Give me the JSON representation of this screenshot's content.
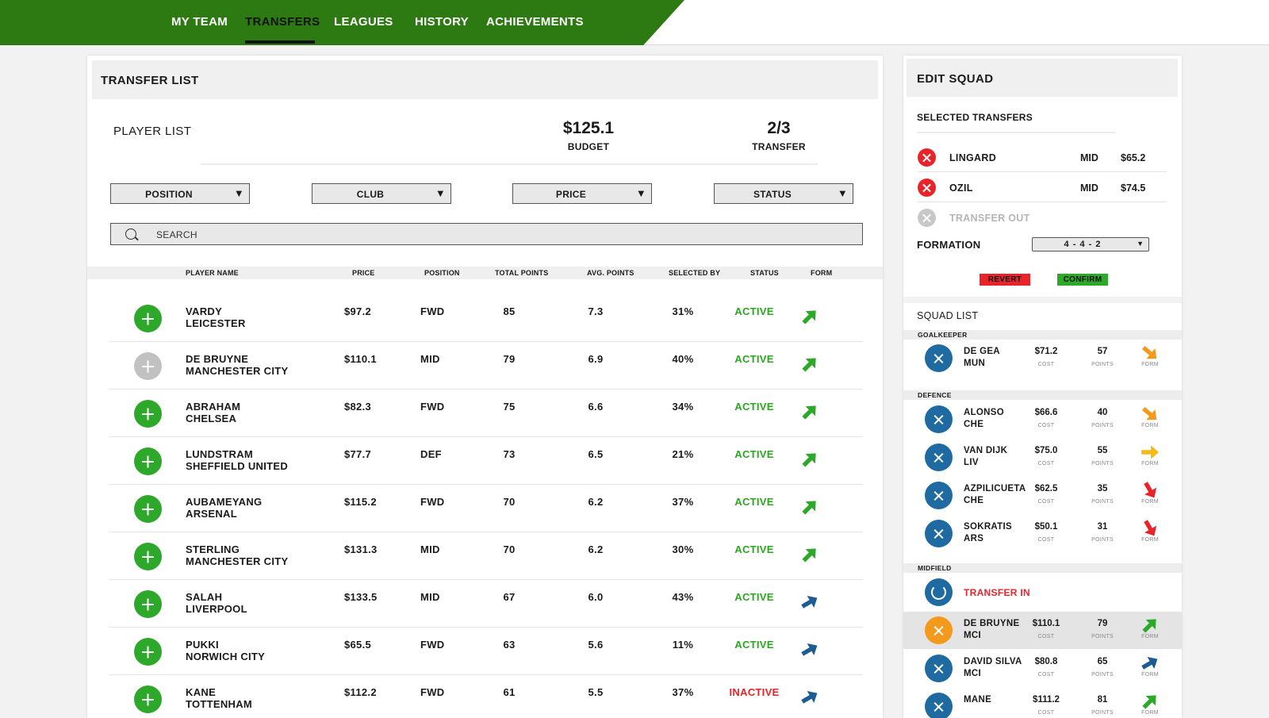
{
  "nav": {
    "items": [
      {
        "label": "MY TEAM"
      },
      {
        "label": "TRANSFERS"
      },
      {
        "label": "LEAGUES"
      },
      {
        "label": "HISTORY"
      },
      {
        "label": "ACHIEVEMENTS"
      }
    ],
    "active": "TRANSFERS"
  },
  "transfer_list": {
    "title": "TRANSFER LIST",
    "player_list_title": "PLAYER LIST",
    "budget_value": "$125.1",
    "budget_label": "BUDGET",
    "transfer_value": "2/3",
    "transfer_label": "TRANSFER",
    "filters": [
      "POSITION",
      "CLUB",
      "PRICE",
      "STATUS"
    ],
    "search_placeholder": "SEARCH",
    "columns": [
      "PLAYER NAME",
      "PRICE",
      "POSITION",
      "TOTAL POINTS",
      "AVG. POINTS",
      "SELECTED BY",
      "STATUS",
      "FORM"
    ],
    "rows": [
      {
        "name": "VARDY",
        "club": "LEICESTER",
        "price": "$97.2",
        "position": "FWD",
        "total": "85",
        "avg": "7.3",
        "selected": "31%",
        "status": "ACTIVE",
        "form": "green-up",
        "add": "green"
      },
      {
        "name": "DE BRUYNE",
        "club": "MANCHESTER CITY",
        "price": "$110.1",
        "position": "MID",
        "total": "79",
        "avg": "6.9",
        "selected": "40%",
        "status": "ACTIVE",
        "form": "green-up",
        "add": "grey"
      },
      {
        "name": "ABRAHAM",
        "club": "CHELSEA",
        "price": "$82.3",
        "position": "FWD",
        "total": "75",
        "avg": "6.6",
        "selected": "34%",
        "status": "ACTIVE",
        "form": "green-up",
        "add": "green"
      },
      {
        "name": "LUNDSTRAM",
        "club": "SHEFFIELD UNITED",
        "price": "$77.7",
        "position": "DEF",
        "total": "73",
        "avg": "6.5",
        "selected": "21%",
        "status": "ACTIVE",
        "form": "green-up",
        "add": "green"
      },
      {
        "name": "AUBAMEYANG",
        "club": "ARSENAL",
        "price": "$115.2",
        "position": "FWD",
        "total": "70",
        "avg": "6.2",
        "selected": "37%",
        "status": "ACTIVE",
        "form": "green-up",
        "add": "green"
      },
      {
        "name": "STERLING",
        "club": "MANCHESTER CITY",
        "price": "$131.3",
        "position": "MID",
        "total": "70",
        "avg": "6.2",
        "selected": "30%",
        "status": "ACTIVE",
        "form": "green-up",
        "add": "green"
      },
      {
        "name": "SALAH",
        "club": "LIVERPOOL",
        "price": "$133.5",
        "position": "MID",
        "total": "67",
        "avg": "6.0",
        "selected": "43%",
        "status": "ACTIVE",
        "form": "blue-up",
        "add": "green"
      },
      {
        "name": "PUKKI",
        "club": "NORWICH CITY",
        "price": "$65.5",
        "position": "FWD",
        "total": "63",
        "avg": "5.6",
        "selected": "11%",
        "status": "ACTIVE",
        "form": "blue-up",
        "add": "green"
      },
      {
        "name": "KANE",
        "club": "TOTTENHAM",
        "price": "$112.2",
        "position": "FWD",
        "total": "61",
        "avg": "5.5",
        "selected": "37%",
        "status": "INACTIVE",
        "form": "blue-up",
        "add": "green"
      }
    ]
  },
  "edit_squad": {
    "title": "EDIT SQUAD",
    "selected_title": "SELECTED TRANSFERS",
    "selected": [
      {
        "name": "LINGARD",
        "position": "MID",
        "price": "$65.2"
      },
      {
        "name": "OZIL",
        "position": "MID",
        "price": "$74.5"
      },
      {
        "name": "TRANSFER OUT",
        "position": "",
        "price": ""
      }
    ],
    "formation_label": "FORMATION",
    "formation_value": "4 - 4 - 2",
    "revert_label": "REVERT",
    "confirm_label": "CONFIRM",
    "squad_title": "SQUAD LIST",
    "cost_caption": "COST",
    "points_caption": "POINTS",
    "form_caption": "FORM",
    "groups": {
      "goalkeeper": "GOALKEEPER",
      "defence": "DEFENCE",
      "midfield": "MIDFIELD"
    },
    "goalkeepers": [
      {
        "name": "DE GEA",
        "club": "MUN",
        "cost": "$71.2",
        "points": "57",
        "form": "orange-down"
      }
    ],
    "defenders": [
      {
        "name": "ALONSO",
        "club": "CHE",
        "cost": "$66.6",
        "points": "40",
        "form": "orange-down"
      },
      {
        "name": "VAN DIJK",
        "club": "LIV",
        "cost": "$75.0",
        "points": "55",
        "form": "yellow-right"
      },
      {
        "name": "AZPILICUETA",
        "club": "CHE",
        "cost": "$62.5",
        "points": "35",
        "form": "red-down"
      },
      {
        "name": "SOKRATIS",
        "club": "ARS",
        "cost": "$50.1",
        "points": "31",
        "form": "red-down"
      }
    ],
    "transfer_in_label": "TRANSFER IN",
    "midfielders": [
      {
        "name": "DE BRUYNE",
        "club": "MCI",
        "cost": "$110.1",
        "points": "79",
        "form": "green-up",
        "highlight": true
      },
      {
        "name": "DAVID SILVA",
        "club": "MCI",
        "cost": "$80.8",
        "points": "65",
        "form": "blue-up",
        "highlight": false
      },
      {
        "name": "MANE",
        "club": "",
        "cost": "$111.2",
        "points": "81",
        "form": "green-up",
        "highlight": false
      }
    ]
  },
  "colors": {
    "brand_green": "#2d7a12",
    "active": "#28a81d",
    "inactive": "#e8232a",
    "blue": "#1f6aa0",
    "orange": "#f39a1c"
  }
}
